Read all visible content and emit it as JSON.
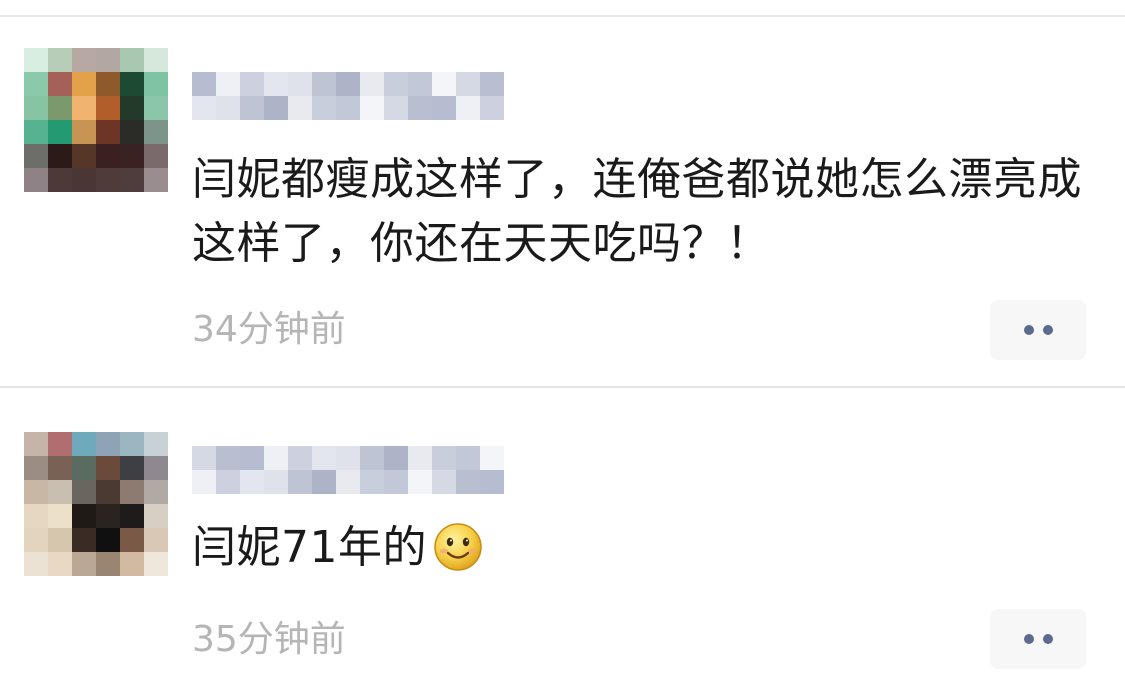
{
  "comments": [
    {
      "text": "闫妮都瘦成这样了，连俺爸都说她怎么漂亮成这样了，你还在天天吃吗？！",
      "timestamp": "34分钟前",
      "emoji": null,
      "avatar_blurred": true,
      "username_blurred": true
    },
    {
      "text": "闫妮71年的",
      "timestamp": "35分钟前",
      "emoji": "smiling-face-icon",
      "avatar_blurred": true,
      "username_blurred": true
    }
  ],
  "colors": {
    "text": "#1a1a1a",
    "timestamp": "#b5b5b5",
    "more_dots": "#5b6b8f",
    "more_button_bg": "#f7f7f7",
    "divider": "#e6e6e6"
  }
}
